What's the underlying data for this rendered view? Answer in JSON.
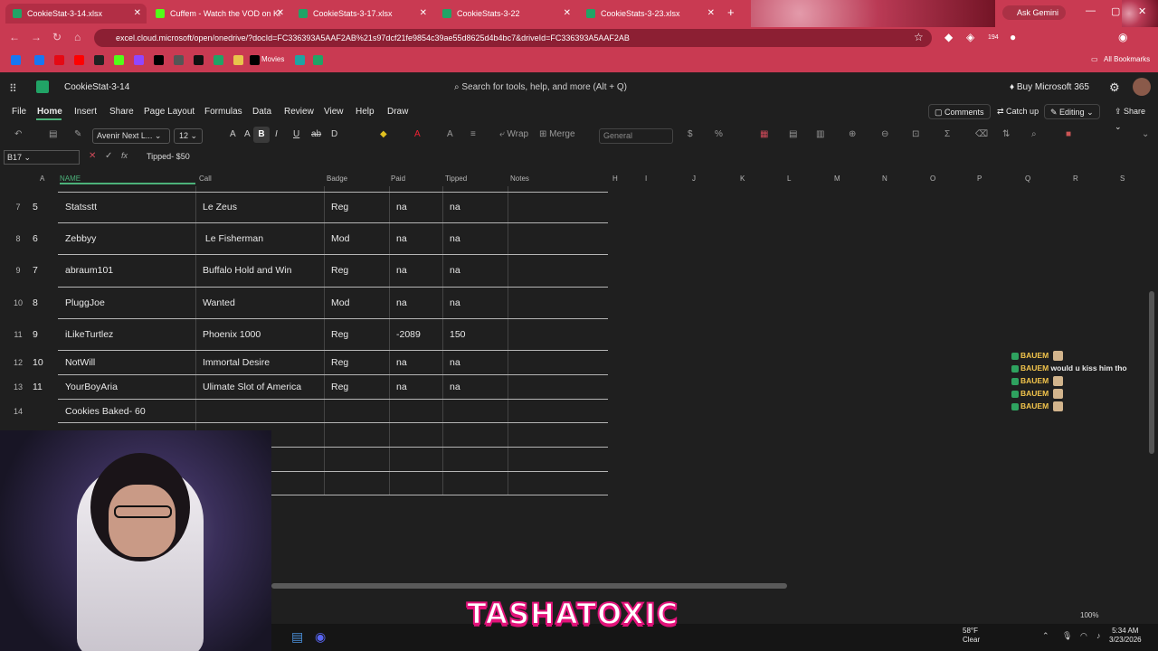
{
  "browser": {
    "tabs": [
      {
        "title": "CookieStat-3-14.xlsx",
        "active": true,
        "icon": "excel-icon"
      },
      {
        "title": "Cuffem - Watch the VOD on Ki",
        "active": false,
        "icon": "kick-icon"
      },
      {
        "title": "CookieStats-3-17.xlsx",
        "active": false,
        "icon": "excel-icon"
      },
      {
        "title": "CookieStats-3-22",
        "active": false,
        "icon": "excel-icon"
      },
      {
        "title": "CookieStats-3-23.xlsx",
        "active": false,
        "icon": "excel-icon"
      }
    ],
    "new_tab": "+",
    "ask_gemini": "Ask Gemini",
    "url": "excel.cloud.microsoft/open/onedrive/?docId=FC336393A5AAF2AB%21s97dcf21fe9854c39ae55d8625d4b4bc7&driveId=FC336393A5AAF2AB",
    "bookmarks": {
      "movies": "Movies",
      "all": "All Bookmarks"
    },
    "ext_badge": "194"
  },
  "excel": {
    "doc_name": "CookieStat-3-14",
    "search_placeholder": "Search for tools, help, and more (Alt + Q)",
    "buy": "Buy Microsoft 365",
    "menu": [
      "File",
      "Home",
      "Insert",
      "Share",
      "Page Layout",
      "Formulas",
      "Data",
      "Review",
      "View",
      "Help",
      "Draw"
    ],
    "right_pills": {
      "comments": "Comments",
      "catchup": "Catch up",
      "editing": "Editing",
      "share": "Share"
    },
    "ribbon": {
      "font": "Avenir Next L...",
      "size": "12",
      "wrap": "Wrap",
      "merge": "Merge",
      "number_format": "General"
    },
    "name_box": "B17",
    "formula": "Tipped- $50",
    "columns": {
      "A": "A",
      "B": "NAME",
      "C": "Call",
      "D": "Badge",
      "E": "Paid",
      "F": "Tipped",
      "G": "Notes",
      "H": "H",
      "I": "I",
      "J": "J",
      "K": "K",
      "L": "L",
      "M": "M",
      "N": "N",
      "O": "O",
      "P": "P",
      "Q": "Q",
      "R": "R",
      "S": "S"
    },
    "rows": [
      {
        "row": "7",
        "num": "5",
        "name": "Statsstt",
        "call": "Le Zeus",
        "badge": "Reg",
        "paid": "na",
        "tipped": "na"
      },
      {
        "row": "8",
        "num": "6",
        "name": "Zebbyy",
        "call": " Le Fisherman",
        "badge": "Mod",
        "paid": "na",
        "tipped": "na"
      },
      {
        "row": "9",
        "num": "7",
        "name": "abraum101",
        "call": "Buffalo Hold and Win",
        "badge": "Reg",
        "paid": "na",
        "tipped": "na"
      },
      {
        "row": "10",
        "num": "8",
        "name": "PluggJoe",
        "call": "Wanted",
        "badge": "Mod",
        "paid": "na",
        "tipped": "na"
      },
      {
        "row": "11",
        "num": "9",
        "name": "iLikeTurtlez",
        "call": "Phoenix 1000",
        "badge": "Reg",
        "paid": "-2089",
        "tipped": "150"
      },
      {
        "row": "12",
        "num": "10",
        "name": "NotWill",
        "call": "Immortal Desire",
        "badge": "Reg",
        "paid": "na",
        "tipped": "na"
      },
      {
        "row": "13",
        "num": "11",
        "name": "YourBoyAria",
        "call": "Ulimate Slot of America",
        "badge": "Reg",
        "paid": "na",
        "tipped": "na"
      },
      {
        "row": "14",
        "num": "",
        "name": "Cookies Baked- 60",
        "call": "",
        "badge": "",
        "paid": "",
        "tipped": ""
      }
    ],
    "zoom": "100%"
  },
  "chat": [
    {
      "user": "BAUEM",
      "message": ""
    },
    {
      "user": "BAUEM",
      "message": "would u kiss him tho"
    },
    {
      "user": "BAUEM",
      "message": ""
    },
    {
      "user": "BAUEM",
      "message": ""
    },
    {
      "user": "BAUEM",
      "message": ""
    }
  ],
  "overlay": {
    "brand": "TASHATOXIC"
  },
  "taskbar": {
    "temp": "58°F",
    "condition": "Clear",
    "time": "5:34 AM",
    "date": "3/23/2026"
  },
  "colors": {
    "chrome": "#c93a52",
    "excel_green": "#21a366",
    "brand_pink": "#e2127a",
    "chat_user": "#f3c54c"
  }
}
